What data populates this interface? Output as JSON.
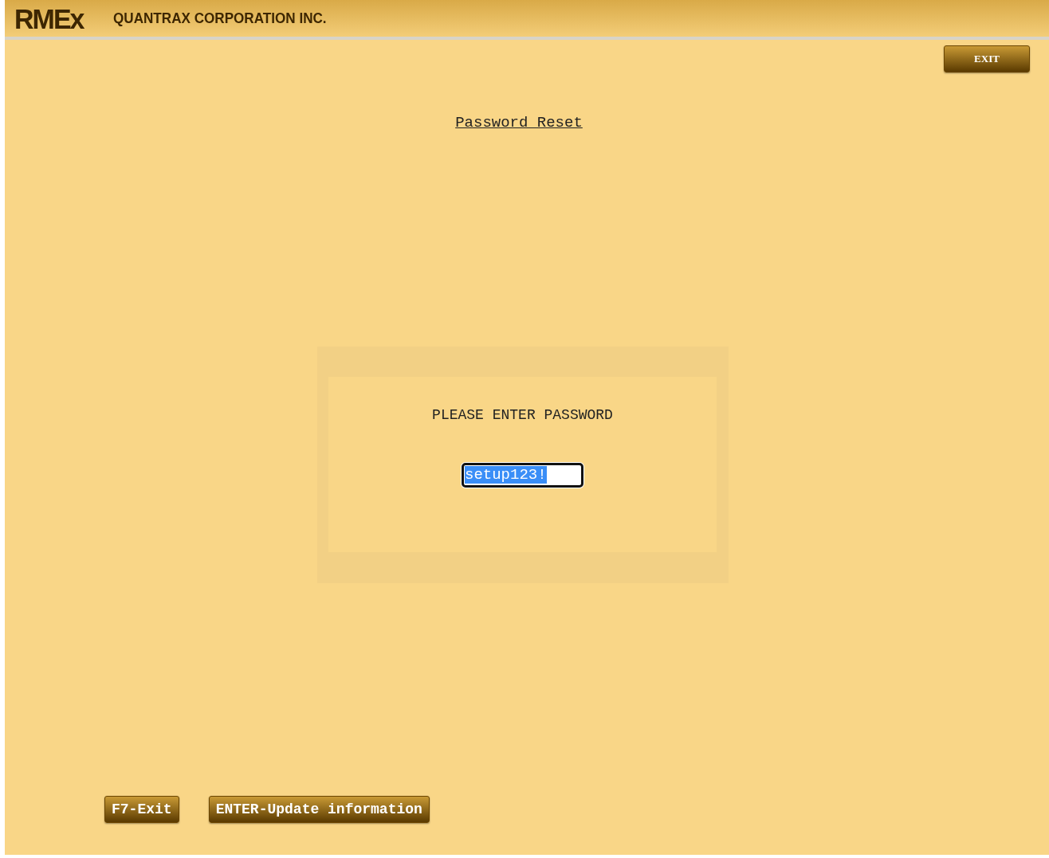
{
  "header": {
    "logo": "RMEx",
    "company": "QUANTRAX CORPORATION INC."
  },
  "exit_button": "EXIT",
  "title": "Password Reset",
  "prompt": {
    "label": "PLEASE ENTER PASSWORD",
    "value": "setup123!",
    "text_selected": true
  },
  "function_keys": [
    {
      "label": "F7-Exit"
    },
    {
      "label": "ENTER-Update information"
    }
  ]
}
